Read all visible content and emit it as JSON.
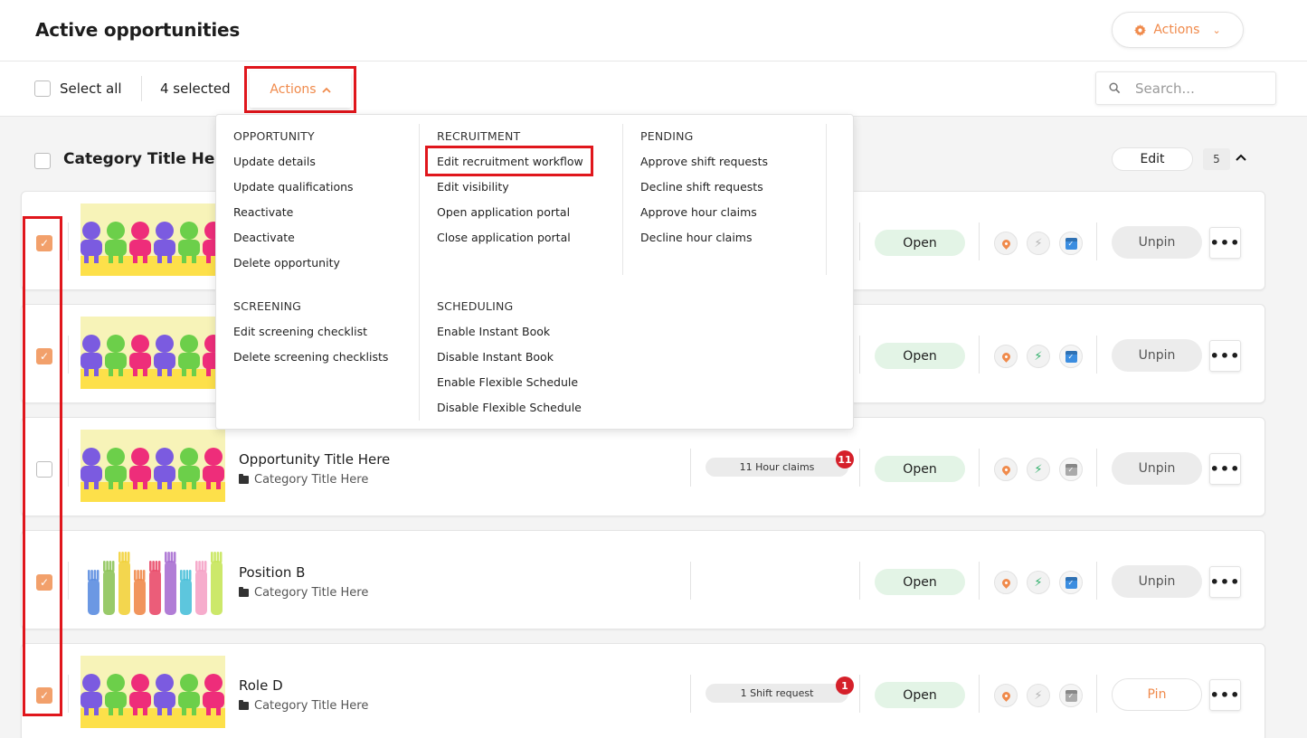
{
  "header": {
    "title": "Active opportunities",
    "actions_label": "Actions"
  },
  "toolbar": {
    "select_all_label": "Select all",
    "selected_count": "4 selected",
    "actions_label": "Actions",
    "search_placeholder": "Search..."
  },
  "category": {
    "title": "Category Title Here",
    "edit_label": "Edit",
    "count": "5"
  },
  "dropdown": {
    "opportunity": {
      "heading": "OPPORTUNITY",
      "items": [
        "Update details",
        "Update qualifications",
        "Reactivate",
        "Deactivate",
        "Delete opportunity"
      ]
    },
    "screening": {
      "heading": "SCREENING",
      "items": [
        "Edit screening checklist",
        "Delete screening checklists"
      ]
    },
    "recruitment": {
      "heading": "RECRUITMENT",
      "items": [
        "Edit recruitment workflow",
        "Edit visibility",
        "Open application portal",
        "Close application portal"
      ]
    },
    "scheduling": {
      "heading": "SCHEDULING",
      "items": [
        "Enable Instant Book",
        "Disable Instant Book",
        "Enable Flexible Schedule",
        "Disable Flexible Schedule"
      ]
    },
    "pending": {
      "heading": "PENDING",
      "items": [
        "Approve shift requests",
        "Decline shift requests",
        "Approve hour claims",
        "Decline hour claims"
      ]
    }
  },
  "cards": [
    {
      "checked": true,
      "title": "",
      "category": "",
      "pill": "",
      "badge": "",
      "status": "Open",
      "pin_label": "Unpin",
      "bolt_active": false,
      "cal_active": true
    },
    {
      "checked": true,
      "title": "",
      "category": "",
      "pill": "",
      "badge": "",
      "status": "Open",
      "pin_label": "Unpin",
      "bolt_active": true,
      "cal_active": true
    },
    {
      "checked": false,
      "title": "Opportunity Title Here",
      "category": "Category Title Here",
      "pill": "11  Hour claims",
      "badge": "11",
      "status": "Open",
      "pin_label": "Unpin",
      "bolt_active": true,
      "cal_active": false
    },
    {
      "checked": true,
      "title": "Position B",
      "category": "Category Title Here",
      "pill": "",
      "badge": "",
      "status": "Open",
      "pin_label": "Unpin",
      "bolt_active": true,
      "cal_active": true
    },
    {
      "checked": true,
      "title": "Role D",
      "category": "Category Title Here",
      "pill": "1 Shift request",
      "badge": "1",
      "status": "Open",
      "pin_label": "Pin",
      "bolt_active": false,
      "cal_active": false
    }
  ],
  "colors": {
    "accent": "#f08a4b",
    "highlight": "#e0161c",
    "status_open_bg": "#e3f4e6",
    "badge_red": "#d5202a",
    "bolt_active": "#2fb06a",
    "cal_active": "#3b8de0"
  },
  "icons": {
    "gear": "gear-icon",
    "search": "search-icon",
    "pin": "location-pin-icon",
    "bolt": "lightning-bolt-icon",
    "calendar": "calendar-check-icon",
    "folder": "folder-icon",
    "more": "more-horizontal-icon"
  }
}
